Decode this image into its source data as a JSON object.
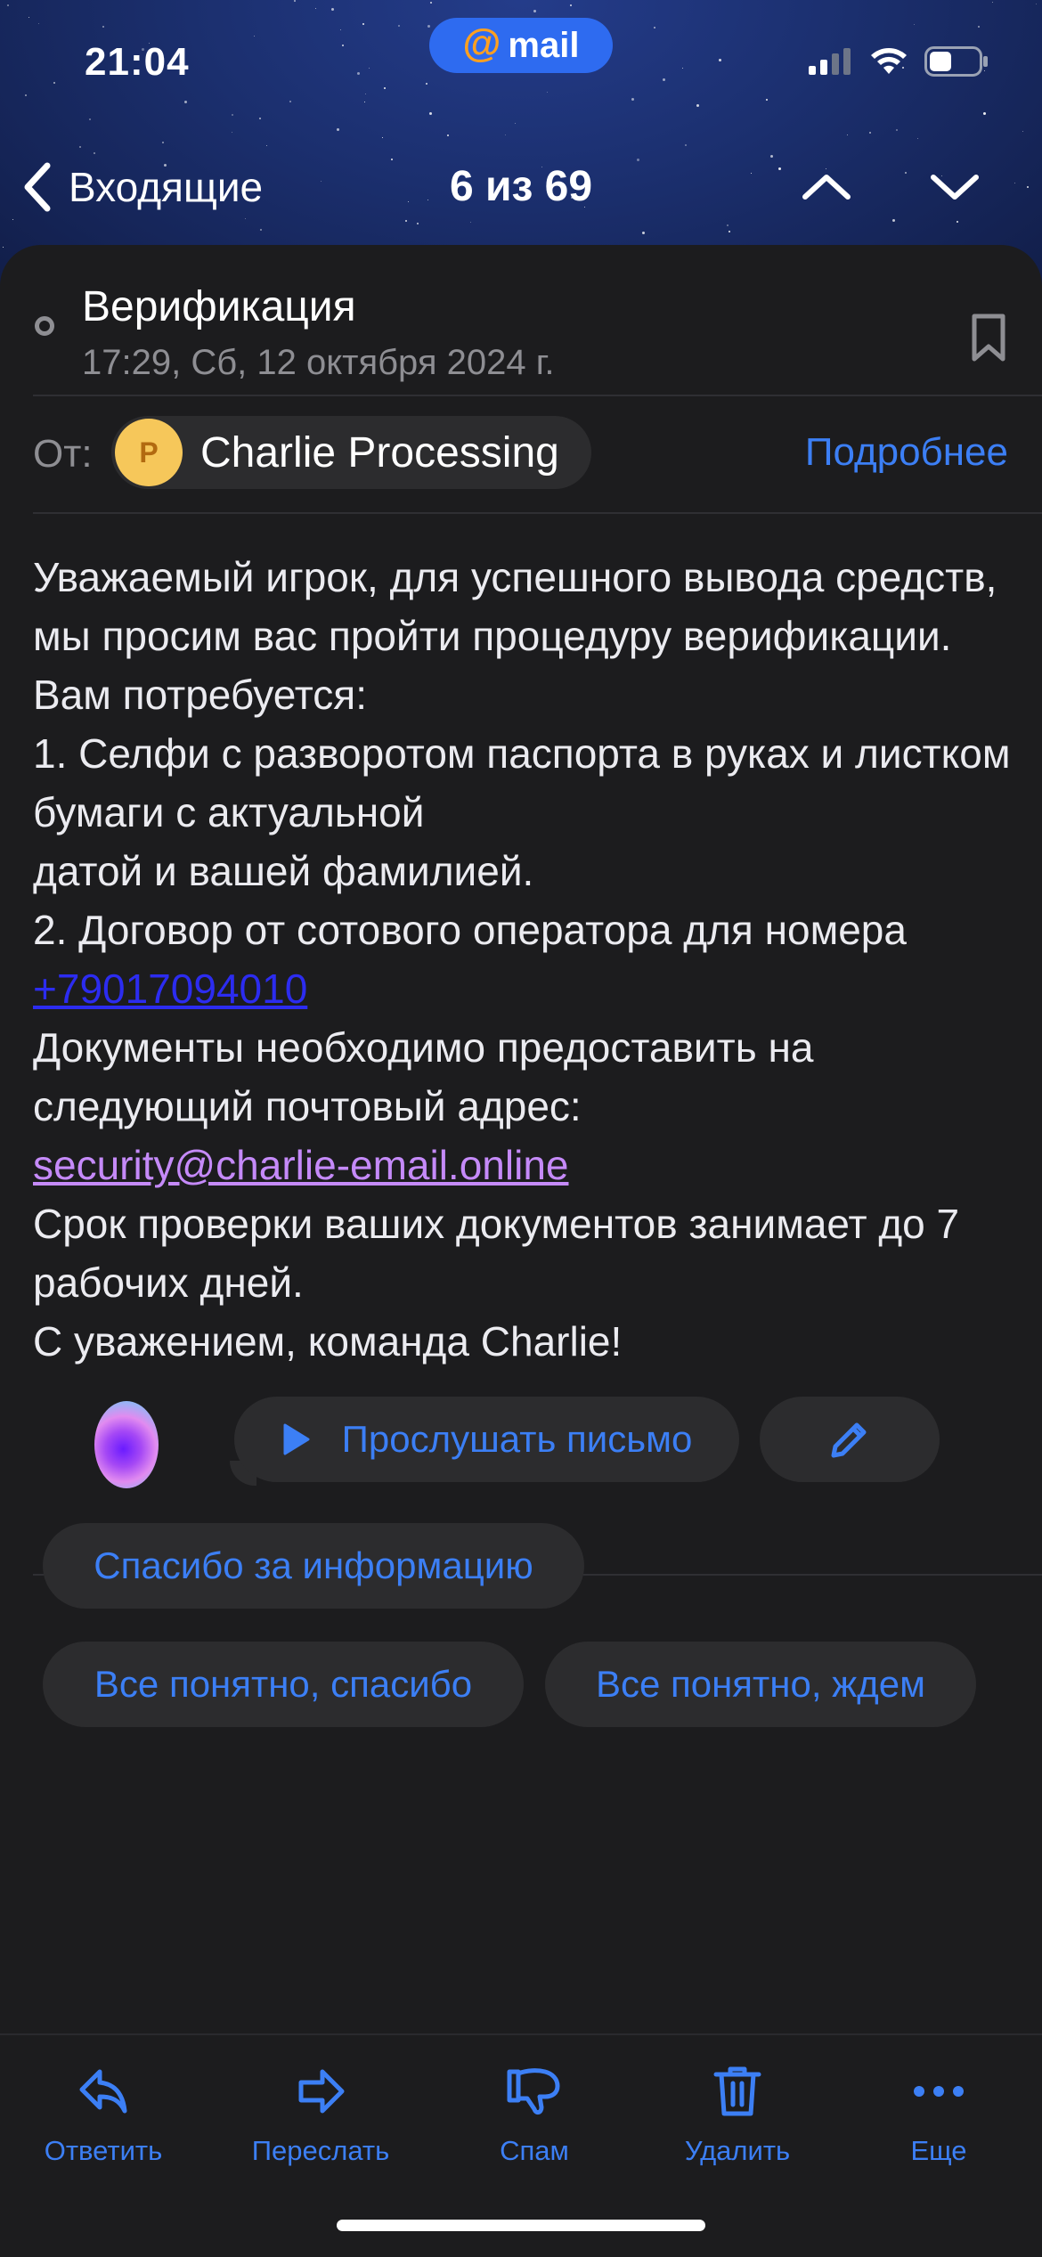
{
  "status_bar": {
    "time": "21:04",
    "app_brand_at": "@",
    "app_brand_word": "mail",
    "battery_level": 0.45
  },
  "nav": {
    "back_label": "Входящие",
    "counter": "6 из 69",
    "prev_icon": "chevron-up-icon",
    "next_icon": "chevron-down-icon"
  },
  "message": {
    "subject": "Верификация",
    "date": "17:29, Сб, 12 октября 2024 г.",
    "from_label": "От:",
    "sender_initial": "P",
    "sender_name": "Charlie Processing",
    "details_link": "Подробнее",
    "body": {
      "l1": "Уважаемый игрок, для успешного вывода средств, мы просим вас пройти процедуру верификации.",
      "l2": "Вам потребуется:",
      "l3": "1. Селфи с разворотом паспорта в руках и листком бумаги с актуальной",
      "l4": "датой и вашей фамилией.",
      "l5": "2. Договор от сотового оператора для номера ",
      "phone": "+79017094010",
      "l6": "Документы необходимо предоставить на следующий почтовый адрес:",
      "email": "security@charlie-email.online",
      "l7": "Срок проверки ваших документов занимает до 7 рабочих дней.",
      "l8": "С уважением, команда Charlie!"
    }
  },
  "assistant": {
    "listen_label": "Прослушать письмо",
    "quick_replies": [
      "Спасибо за информацию",
      "Все понятно, спасибо",
      "Все понятно, ждем"
    ]
  },
  "toolbar": {
    "items": [
      {
        "label": "Ответить",
        "icon": "reply-icon"
      },
      {
        "label": "Переслать",
        "icon": "forward-icon"
      },
      {
        "label": "Спам",
        "icon": "spam-icon"
      },
      {
        "label": "Удалить",
        "icon": "trash-icon"
      },
      {
        "label": "Еще",
        "icon": "more-icon"
      }
    ]
  },
  "colors": {
    "accent": "#3c7ff5",
    "background": "#1c1c1e",
    "surface": "#2c2c2e",
    "secondary_text": "#8e8e93",
    "header_blue": "#1b2f6e",
    "brand_pill": "#2e6bf0",
    "brand_at": "#ffa020",
    "avatar_bg": "#f6c75a",
    "phone_link": "#2c2cf0",
    "email_link": "#c58af9"
  }
}
